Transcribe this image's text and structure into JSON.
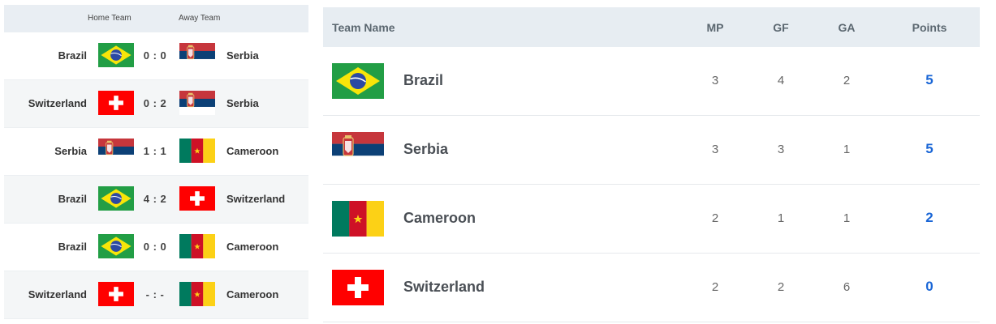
{
  "matches": {
    "header": {
      "home": "Home Team",
      "away": "Away Team"
    },
    "rows": [
      {
        "home": "Brazil",
        "home_flag": "brazil-flag",
        "score": "0 : 0",
        "away": "Serbia",
        "away_flag": "serbia-flag"
      },
      {
        "home": "Switzerland",
        "home_flag": "switzerland-flag",
        "score": "0 : 2",
        "away": "Serbia",
        "away_flag": "serbia-flag"
      },
      {
        "home": "Serbia",
        "home_flag": "serbia-flag",
        "score": "1 : 1",
        "away": "Cameroon",
        "away_flag": "cameroon-flag"
      },
      {
        "home": "Brazil",
        "home_flag": "brazil-flag",
        "score": "4 : 2",
        "away": "Switzerland",
        "away_flag": "switzerland-flag"
      },
      {
        "home": "Brazil",
        "home_flag": "brazil-flag",
        "score": "0 : 0",
        "away": "Cameroon",
        "away_flag": "cameroon-flag"
      },
      {
        "home": "Switzerland",
        "home_flag": "switzerland-flag",
        "score": "- : -",
        "away": "Cameroon",
        "away_flag": "cameroon-flag"
      }
    ]
  },
  "standings": {
    "header": {
      "team": "Team Name",
      "mp": "MP",
      "gf": "GF",
      "ga": "GA",
      "points": "Points"
    },
    "rows": [
      {
        "team": "Brazil",
        "flag": "brazil-flag",
        "mp": "3",
        "gf": "4",
        "ga": "2",
        "points": "5"
      },
      {
        "team": "Serbia",
        "flag": "serbia-flag",
        "mp": "3",
        "gf": "3",
        "ga": "1",
        "points": "5"
      },
      {
        "team": "Cameroon",
        "flag": "cameroon-flag",
        "mp": "2",
        "gf": "1",
        "ga": "1",
        "points": "2"
      },
      {
        "team": "Switzerland",
        "flag": "switzerland-flag",
        "mp": "2",
        "gf": "2",
        "ga": "6",
        "points": "0"
      }
    ]
  },
  "colors": {
    "points": "#1a66d6",
    "header_bg": "#e7edf2",
    "alt_row_bg": "#f4f6f7"
  }
}
